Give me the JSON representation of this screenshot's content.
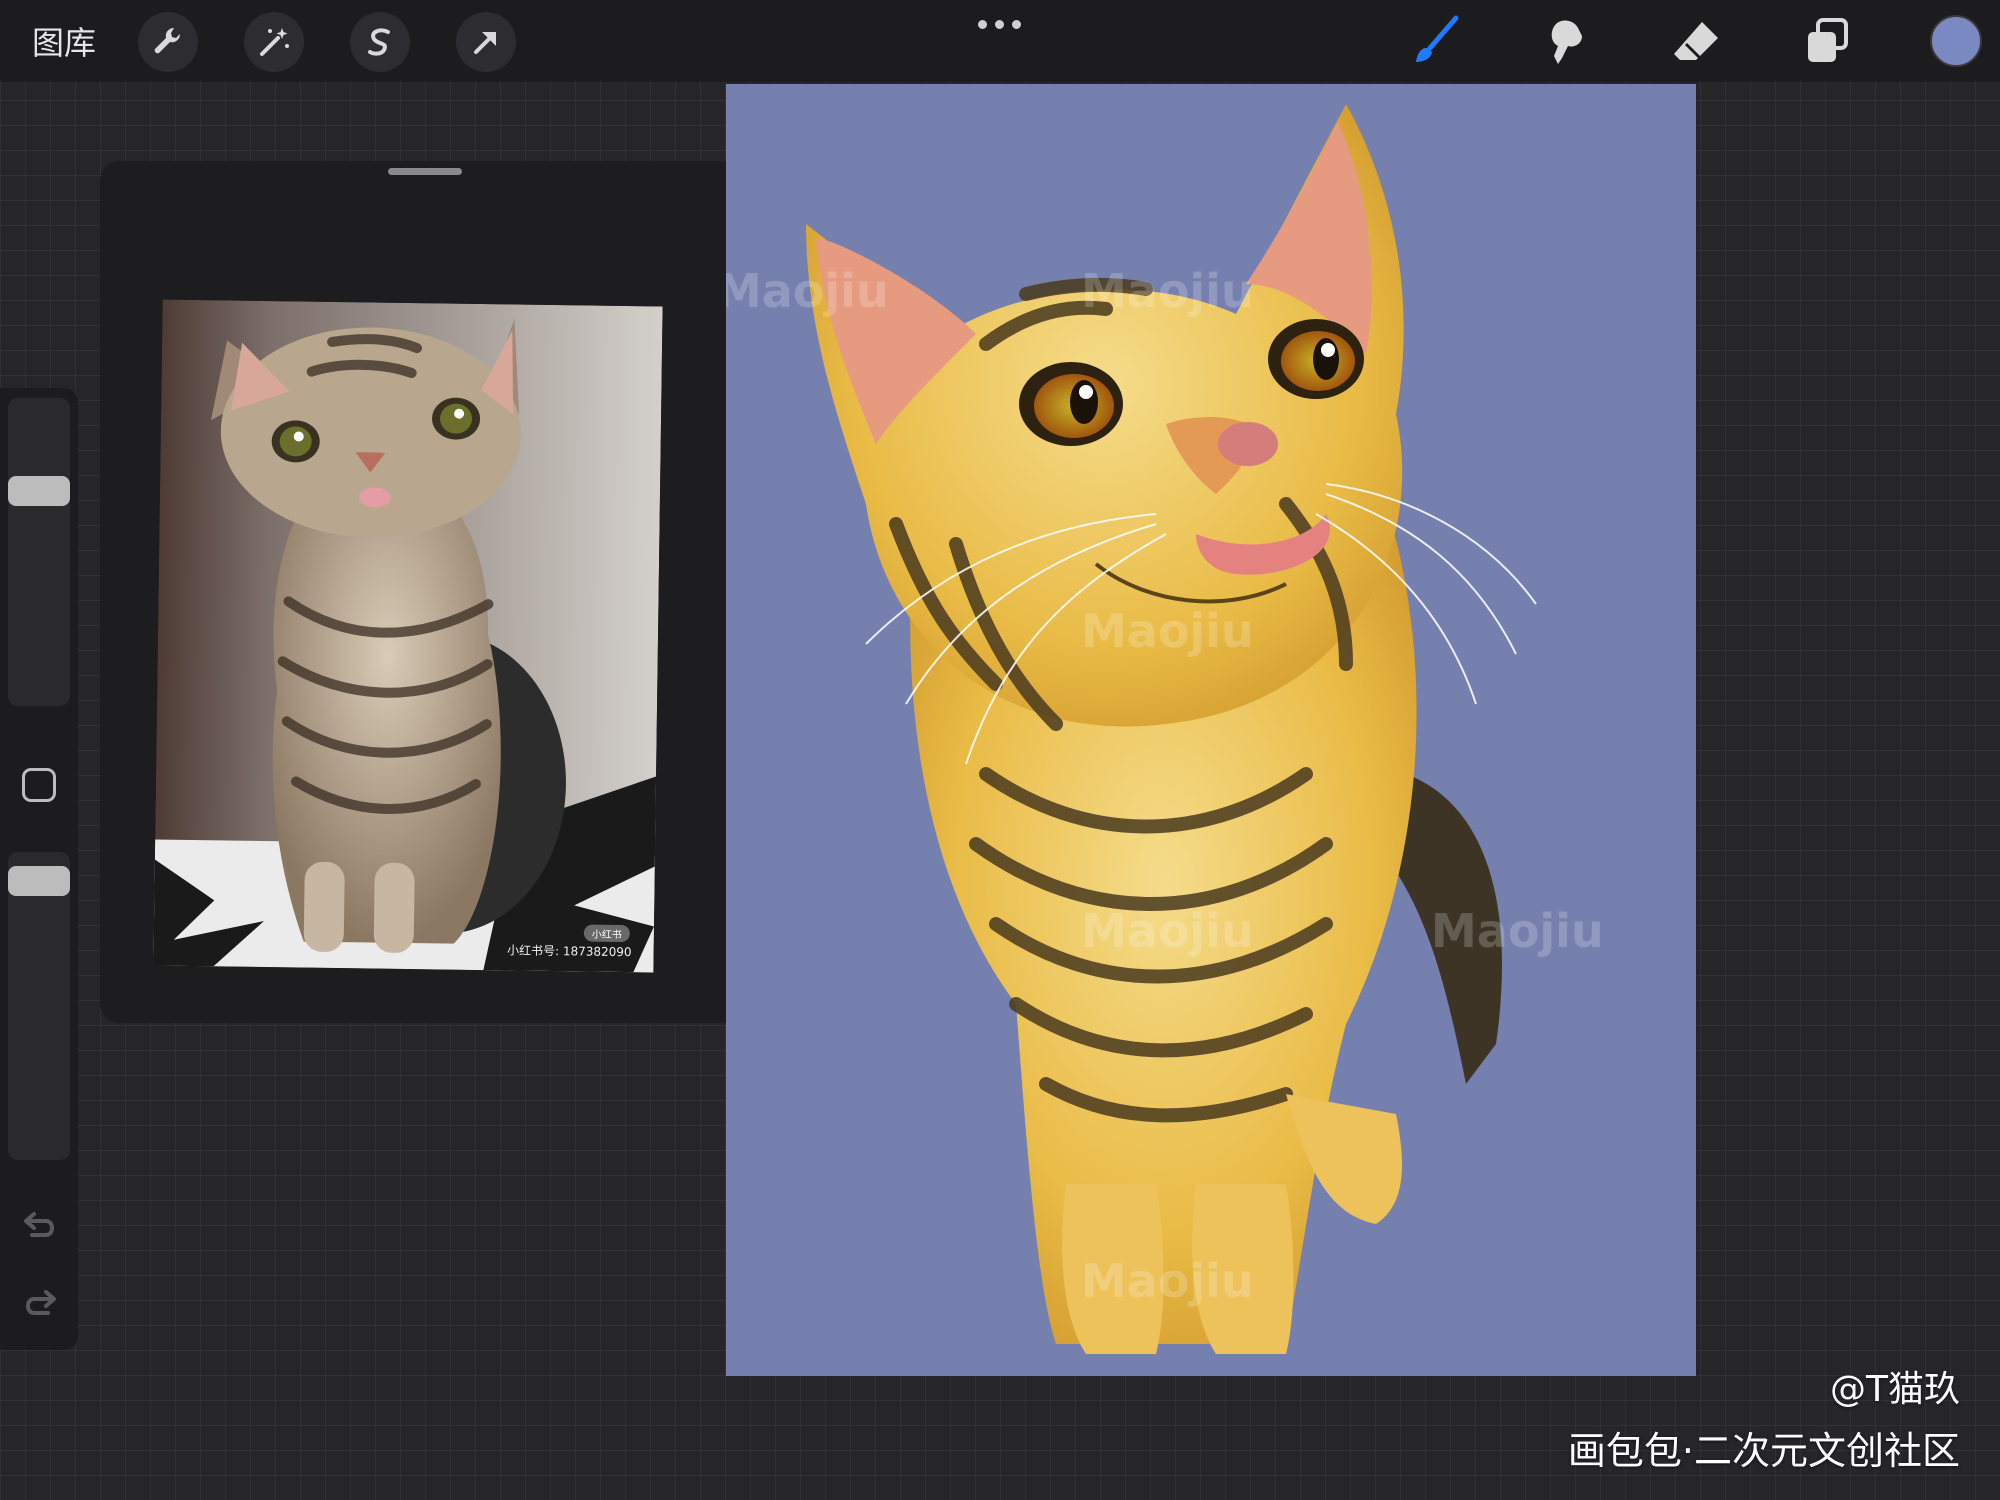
{
  "toolbar": {
    "gallery_label": "图库",
    "left_tools": [
      "wrench-icon",
      "magic-wand-icon",
      "selection-s-icon",
      "transform-arrow-icon"
    ],
    "right_tools": [
      "brush-icon",
      "smudge-icon",
      "eraser-icon",
      "layers-icon"
    ],
    "active_tool": "brush-icon",
    "active_color": "#7b89c3",
    "accent": "#1e7bff"
  },
  "sidebar": {
    "brush_size_level": 0.28,
    "opacity_level": 0.12
  },
  "reference": {
    "caption": "小红书号: 187382090",
    "badge": "小红书"
  },
  "canvas": {
    "background": "#7680ae",
    "watermark_text": "Maojiu"
  },
  "overlay": {
    "credit": "@T猫玖",
    "site": "画包包·二次元文创社区"
  }
}
